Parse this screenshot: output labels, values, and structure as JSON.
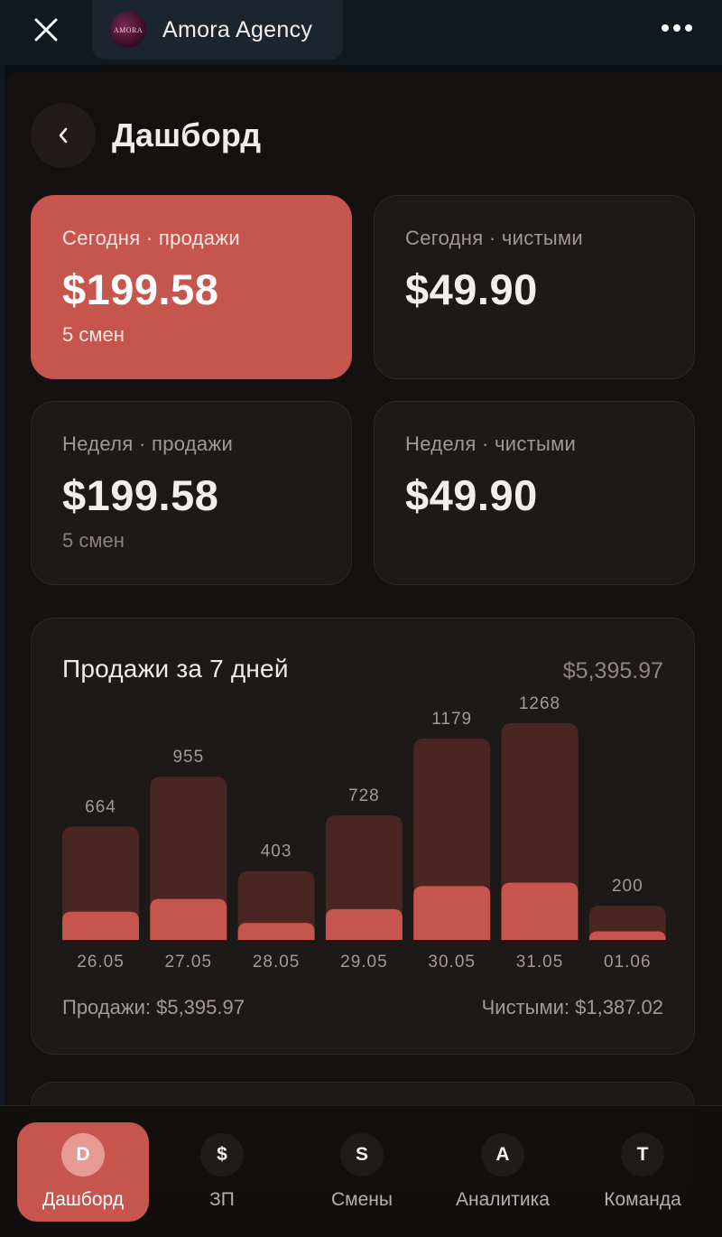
{
  "topbar": {
    "brand_logo_text": "AMORA",
    "brand_name": "Amora Agency"
  },
  "page": {
    "title": "Дашборд"
  },
  "cards": [
    {
      "label": "Сегодня · продажи",
      "value": "$199.58",
      "sub": "5 смен"
    },
    {
      "label": "Сегодня · чистыми",
      "value": "$49.90",
      "sub": ""
    },
    {
      "label": "Неделя · продажи",
      "value": "$199.58",
      "sub": "5 смен"
    },
    {
      "label": "Неделя · чистыми",
      "value": "$49.90",
      "sub": ""
    }
  ],
  "chart": {
    "title": "Продажи за 7 дней",
    "total": "$5,395.97",
    "footer_sales": "Продажи: $5,395.97",
    "footer_net": "Чистыми: $1,387.02"
  },
  "chart_data": {
    "type": "bar",
    "categories": [
      "26.05",
      "27.05",
      "28.05",
      "29.05",
      "30.05",
      "31.05",
      "01.06"
    ],
    "series": [
      {
        "values": [
          664,
          955,
          403,
          728,
          1179,
          1268,
          200
        ]
      },
      {
        "values": [
          165,
          240,
          100,
          180,
          315,
          335,
          50
        ]
      }
    ],
    "data_labels": [
      "664",
      "955",
      "403",
      "728",
      "1179",
      "1268",
      "200"
    ],
    "ylim": [
      0,
      1268
    ],
    "grid": false,
    "colors": {
      "total": "#4a2623",
      "net": "#c6554e"
    }
  },
  "nav": {
    "items": [
      {
        "badge": "D",
        "label": "Дашборд"
      },
      {
        "badge": "$",
        "label": "ЗП"
      },
      {
        "badge": "S",
        "label": "Смены"
      },
      {
        "badge": "A",
        "label": "Аналитика"
      },
      {
        "badge": "T",
        "label": "Команда"
      }
    ]
  },
  "colors": {
    "accent": "#c6554e",
    "background": "#141110",
    "card": "#1c1917"
  }
}
